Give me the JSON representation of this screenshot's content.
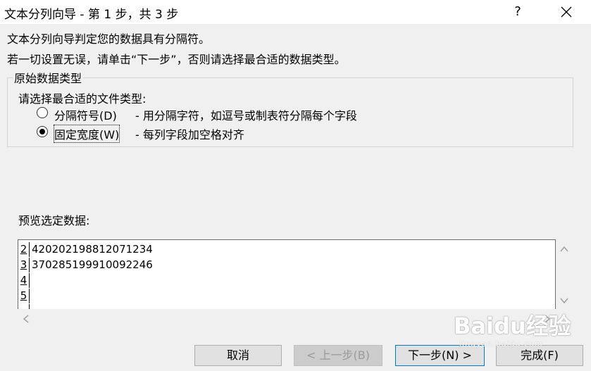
{
  "window": {
    "title": "文本分列向导 - 第 1 步，共 3 步",
    "help_label": "?"
  },
  "intro": {
    "line1": "文本分列向导判定您的数据具有分隔符。",
    "line2": "若一切设置无误，请单击“下一步”，否则请选择最合适的数据类型。"
  },
  "original_type": {
    "legend": "原始数据类型",
    "prompt": "请选择最合适的文件类型:",
    "options": [
      {
        "label": "分隔符号(D)",
        "description": "- 用分隔字符，如逗号或制表符分隔每个字段",
        "selected": false
      },
      {
        "label": "固定宽度(W)",
        "description": "- 每列字段加空格对齐",
        "selected": true
      }
    ]
  },
  "preview": {
    "label": "预览选定数据:",
    "rows": [
      {
        "num": "2",
        "value": "420202198812071234"
      },
      {
        "num": "3",
        "value": "370285199910092246"
      },
      {
        "num": "4",
        "value": ""
      },
      {
        "num": "5",
        "value": ""
      }
    ]
  },
  "buttons": {
    "cancel": "取消",
    "prev": "< 上一步(B)",
    "next": "下一步(N) >",
    "finish": "完成(F)"
  },
  "watermark": {
    "main": "Baidu经验",
    "sub": "jingyan.baidu.com"
  },
  "icons": {
    "close": "close-icon",
    "scroll_up": "chevron-up-icon",
    "scroll_down": "chevron-down-icon",
    "scroll_left": "chevron-left-icon",
    "scroll_right": "chevron-right-icon"
  }
}
